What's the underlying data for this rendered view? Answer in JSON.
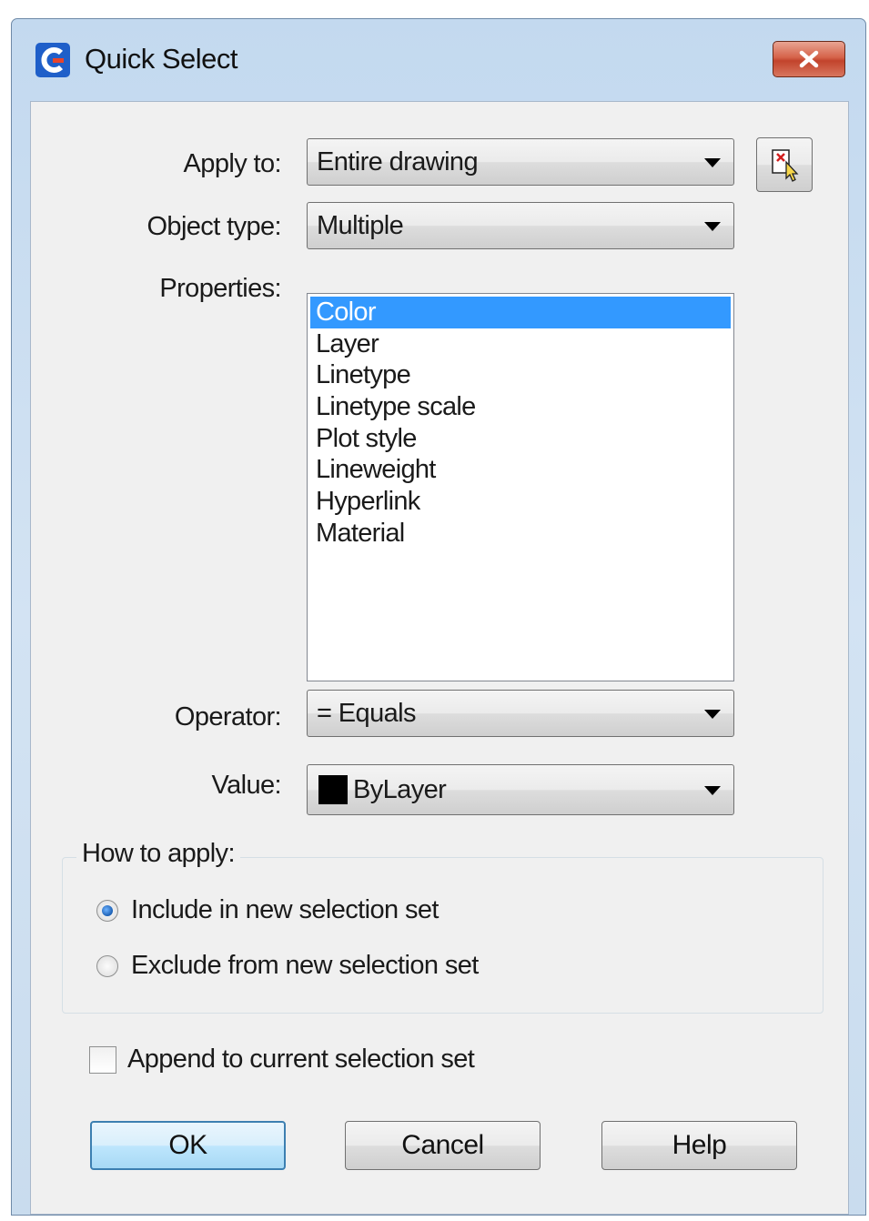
{
  "window": {
    "title": "Quick Select",
    "icon": "app-logo-icon",
    "close_icon": "close-icon"
  },
  "form": {
    "apply_to": {
      "label": "Apply to:",
      "value": "Entire drawing"
    },
    "select_objects_icon": "select-objects-icon",
    "object_type": {
      "label": "Object type:",
      "value": "Multiple"
    },
    "properties": {
      "label": "Properties:",
      "items": [
        "Color",
        "Layer",
        "Linetype",
        "Linetype scale",
        "Plot style",
        "Lineweight",
        "Hyperlink",
        "Material"
      ],
      "selected": "Color"
    },
    "operator": {
      "label": "Operator:",
      "value": "= Equals"
    },
    "value": {
      "label": "Value:",
      "value": "ByLayer",
      "swatch_color": "#000000"
    }
  },
  "how_to_apply": {
    "title": "How to apply:",
    "options": [
      {
        "label": "Include in new selection set",
        "checked": true
      },
      {
        "label": "Exclude from new selection set",
        "checked": false
      }
    ]
  },
  "append": {
    "label": "Append to current selection set",
    "checked": false
  },
  "buttons": {
    "ok": "OK",
    "cancel": "Cancel",
    "help": "Help"
  },
  "colors": {
    "accent": "#3399ff",
    "close_button": "#c7432c",
    "title_bar": "#c9dcee"
  }
}
